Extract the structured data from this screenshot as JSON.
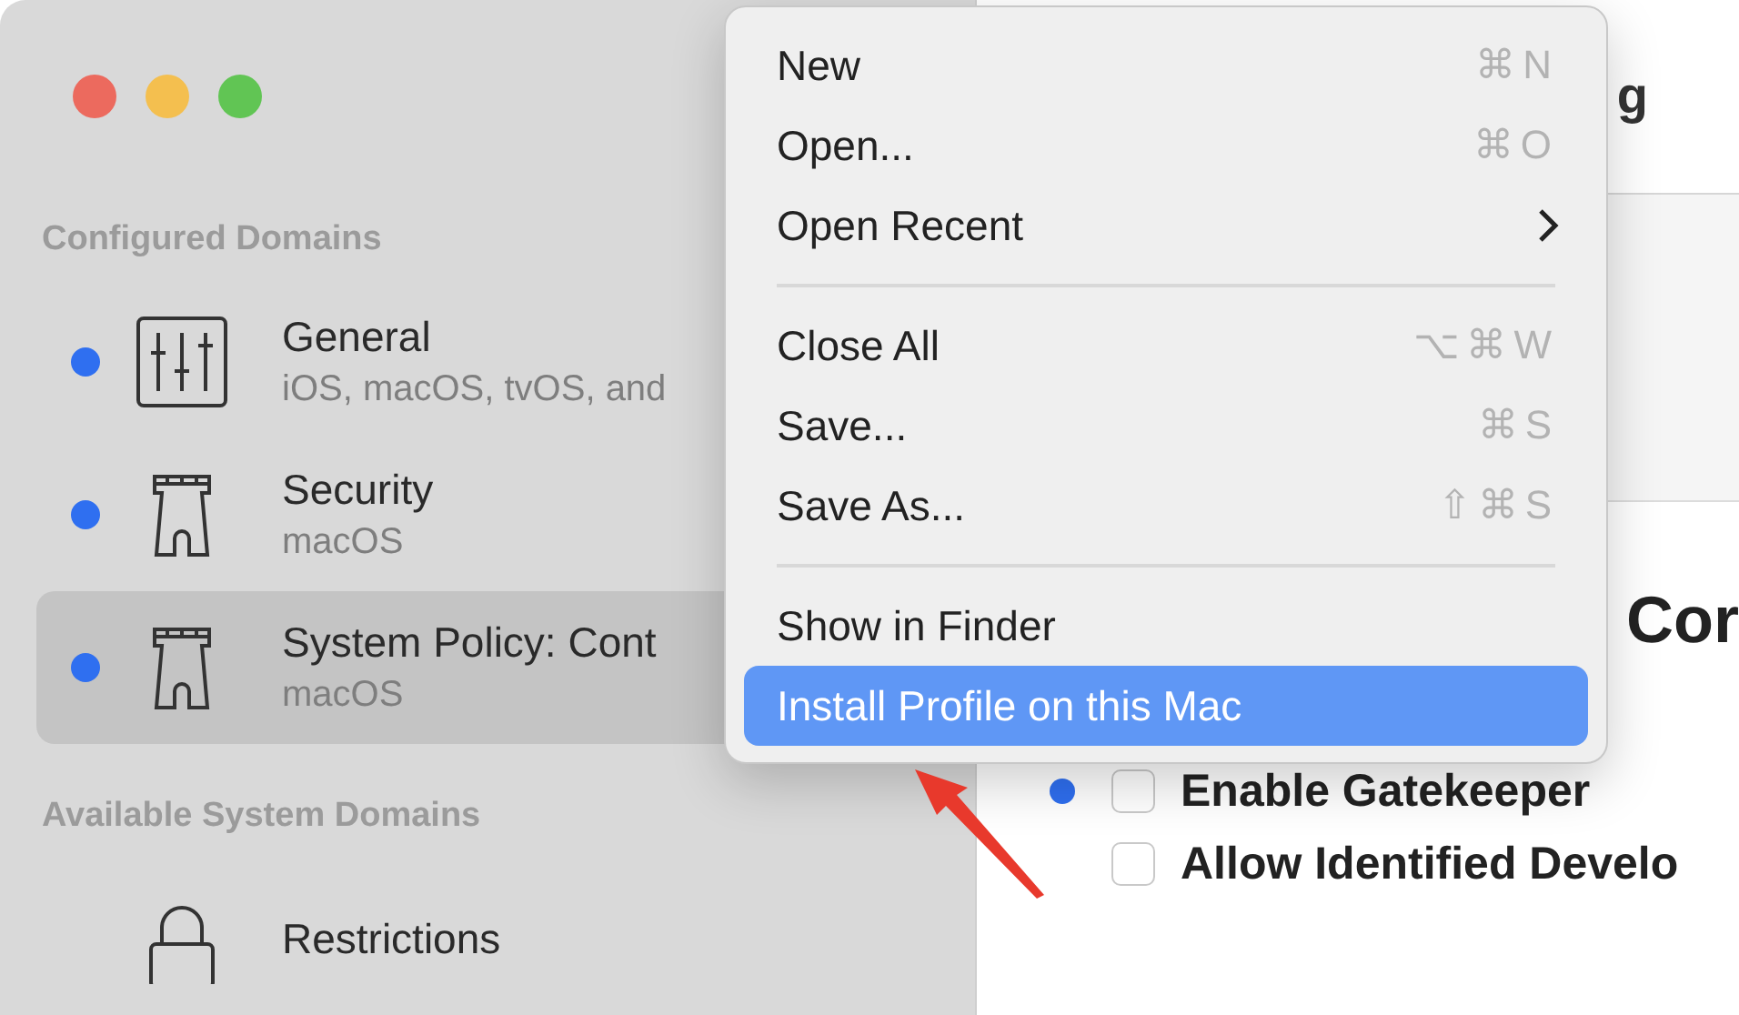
{
  "sidebar": {
    "sections": [
      {
        "title": "Configured Domains",
        "items": [
          {
            "kind": "sliders",
            "title": "General",
            "subtitle": "iOS, macOS, tvOS, and",
            "configured": true,
            "selected": false
          },
          {
            "kind": "tower",
            "title": "Security",
            "subtitle": "macOS",
            "configured": true,
            "selected": false
          },
          {
            "kind": "tower",
            "title": "System Policy: Cont",
            "subtitle": "macOS",
            "configured": true,
            "selected": true
          }
        ]
      },
      {
        "title": "Available System Domains",
        "items": [
          {
            "kind": "lock",
            "title": "Restrictions",
            "configured": false,
            "selected": false
          }
        ]
      }
    ]
  },
  "detail": {
    "title": "g",
    "heading": "Cor",
    "options": [
      {
        "label": "Enable Gatekeeper",
        "configured": true,
        "checked": false
      },
      {
        "label": "Allow Identified Develo",
        "configured": false,
        "checked": false
      }
    ]
  },
  "menu": {
    "groups": [
      [
        {
          "label": "New",
          "shortcut": "⌘N",
          "selected": false
        },
        {
          "label": "Open...",
          "shortcut": "⌘O",
          "selected": false
        },
        {
          "label": "Open Recent",
          "submenu": true,
          "selected": false
        }
      ],
      [
        {
          "label": "Close All",
          "shortcut": "⌥⌘W",
          "selected": false
        },
        {
          "label": "Save...",
          "shortcut": "⌘S",
          "selected": false
        },
        {
          "label": "Save As...",
          "shortcut": "⇧⌘S",
          "selected": false
        }
      ],
      [
        {
          "label": "Show in Finder",
          "selected": false
        },
        {
          "label": "Install Profile on this Mac",
          "selected": true
        }
      ]
    ]
  }
}
